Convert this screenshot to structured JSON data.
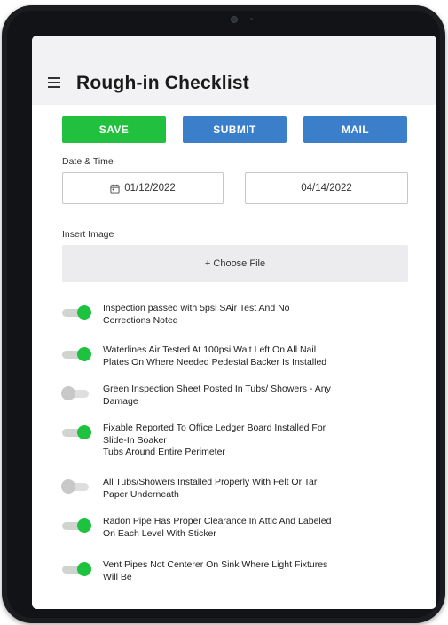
{
  "app": {
    "title": "Rough-in Checklist"
  },
  "actions": {
    "save_label": "SAVE",
    "submit_label": "SUBMIT",
    "mail_label": "MAIL"
  },
  "datetime": {
    "label": "Date & Time",
    "start_date": "01/12/2022",
    "end_date": "04/14/2022"
  },
  "image": {
    "label": "Insert Image",
    "choose_file_label": "+ Choose File"
  },
  "checklist": [
    {
      "text": "Inspection passed with 5psi SAir Test And No\nCorrections Noted",
      "checked": true
    },
    {
      "text": "Waterlines Air Tested At 100psi Wait Left On All Nail\nPlates On Where Needed Pedestal Backer Is Installed",
      "checked": true
    },
    {
      "text": "Green Inspection Sheet Posted In Tubs/ Showers - Any\nDamage",
      "checked": false
    },
    {
      "text": "Fixable Reported To Office Ledger Board Installed For\nSlide-In Soaker\nTubs Around Entire Perimeter",
      "checked": true
    },
    {
      "text": "All Tubs/Showers Installed Properly With Felt Or Tar\nPaper Underneath",
      "checked": false
    },
    {
      "text": "Radon Pipe Has Proper Clearance In Attic And Labeled\nOn Each Level With Sticker",
      "checked": true
    },
    {
      "text": "Vent Pipes Not Centerer On Sink Where Light Fixtures\nWill Be",
      "checked": true
    }
  ],
  "colors": {
    "save": "#22c03f",
    "primary": "#3b7ec9",
    "toggle_on": "#1dc23f",
    "toggle_off": "#c8c8c8"
  }
}
